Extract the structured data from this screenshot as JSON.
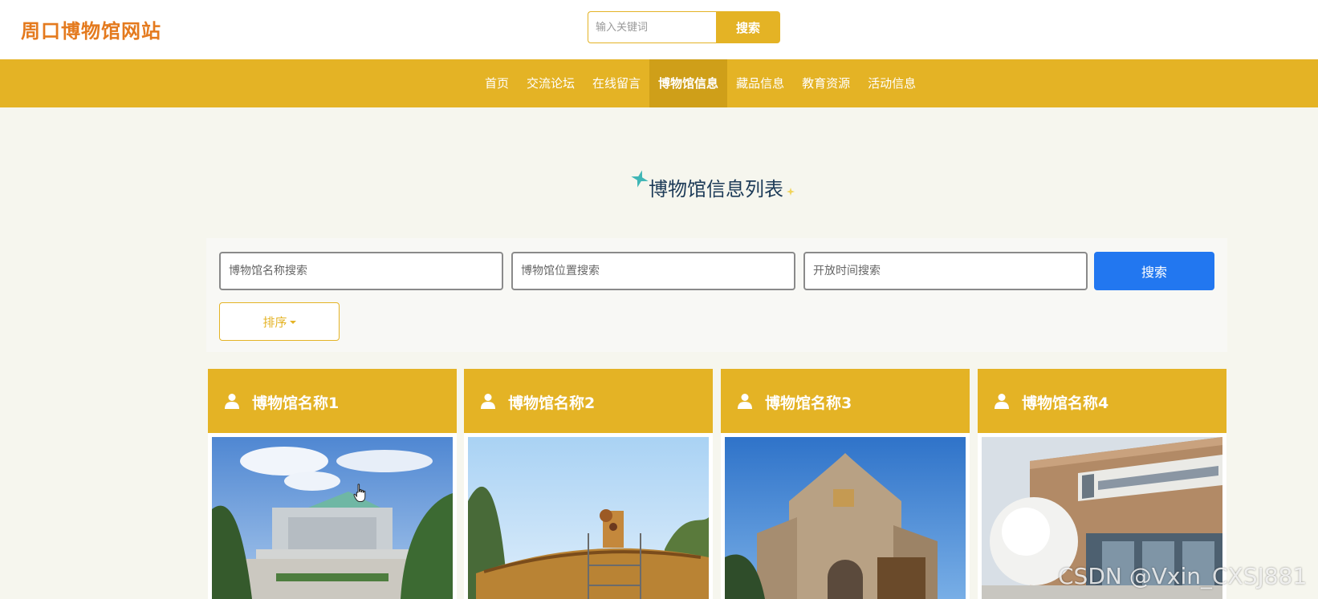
{
  "header": {
    "logo_text": "周口博物馆网站",
    "search": {
      "placeholder": "输入关键词",
      "button_label": "搜索"
    }
  },
  "nav": {
    "items": [
      {
        "label": "首页",
        "active": false
      },
      {
        "label": "交流论坛",
        "active": false
      },
      {
        "label": "在线留言",
        "active": false
      },
      {
        "label": "博物馆信息",
        "active": true
      },
      {
        "label": "藏品信息",
        "active": false
      },
      {
        "label": "教育资源",
        "active": false
      },
      {
        "label": "活动信息",
        "active": false
      }
    ]
  },
  "main": {
    "title": "博物馆信息列表",
    "filters": {
      "name_placeholder": "博物馆名称搜索",
      "location_placeholder": "博物馆位置搜索",
      "opening_time_placeholder": "开放时间搜索",
      "search_button_label": "搜索",
      "sort_button_label": "排序"
    },
    "cards": [
      {
        "name": "博物馆名称1",
        "icon": "user-icon"
      },
      {
        "name": "博物馆名称2",
        "icon": "user-icon"
      },
      {
        "name": "博物馆名称3",
        "icon": "user-icon"
      },
      {
        "name": "博物馆名称4",
        "icon": "user-icon"
      }
    ]
  },
  "watermark": "CSDN @Vxin_CXSJ881",
  "colors": {
    "accent": "#e4b325",
    "accent_dark": "#cf9f19",
    "logo": "#e47a1e",
    "primary_button": "#2277f0",
    "title": "#1d3b58",
    "background": "#f6f6ee"
  }
}
